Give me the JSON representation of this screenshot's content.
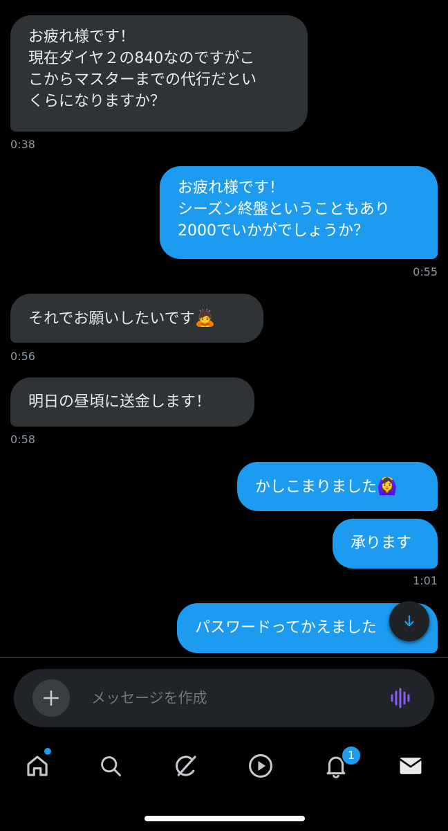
{
  "messages": [
    {
      "direction": "incoming",
      "lines": [
        "お疲れ様です！",
        "現在ダイヤ２の840なのですがこ",
        "こからマスターまでの代行だとい",
        "くらになりますか？"
      ],
      "time": "0:38"
    },
    {
      "direction": "outgoing",
      "lines": [
        "お疲れ様です！",
        "シーズン終盤ということもあり",
        "2000でいかがでしょうか？"
      ],
      "time": "0:55"
    },
    {
      "direction": "incoming",
      "text": "それでお願いしたいです",
      "emoji": "🙇",
      "time": "0:56"
    },
    {
      "direction": "incoming",
      "text": "明日の昼頃に送金します！",
      "time": "0:58"
    },
    {
      "direction": "outgoing",
      "text": "かしこまりました",
      "emoji": "🙆‍♀️"
    },
    {
      "direction": "outgoing",
      "text": "承ります",
      "time": "1:01"
    },
    {
      "direction": "outgoing",
      "text": "パスワードってかえました"
    }
  ],
  "composer": {
    "placeholder": "メッセージを作成",
    "plus_icon": "plus-icon",
    "voice_icon": "voice-waveform-icon"
  },
  "tabbar": {
    "items": [
      "home-icon",
      "search-icon",
      "grok-icon",
      "play-icon",
      "bell-icon",
      "mail-icon"
    ],
    "notifications_badge": "1"
  },
  "colors": {
    "background": "#000000",
    "incoming_bubble": "#303336",
    "outgoing_bubble": "#1d9bf0",
    "timestamp": "#8b98a5",
    "accent": "#1d9bf0",
    "voice_icon": "#8b5cf6"
  }
}
